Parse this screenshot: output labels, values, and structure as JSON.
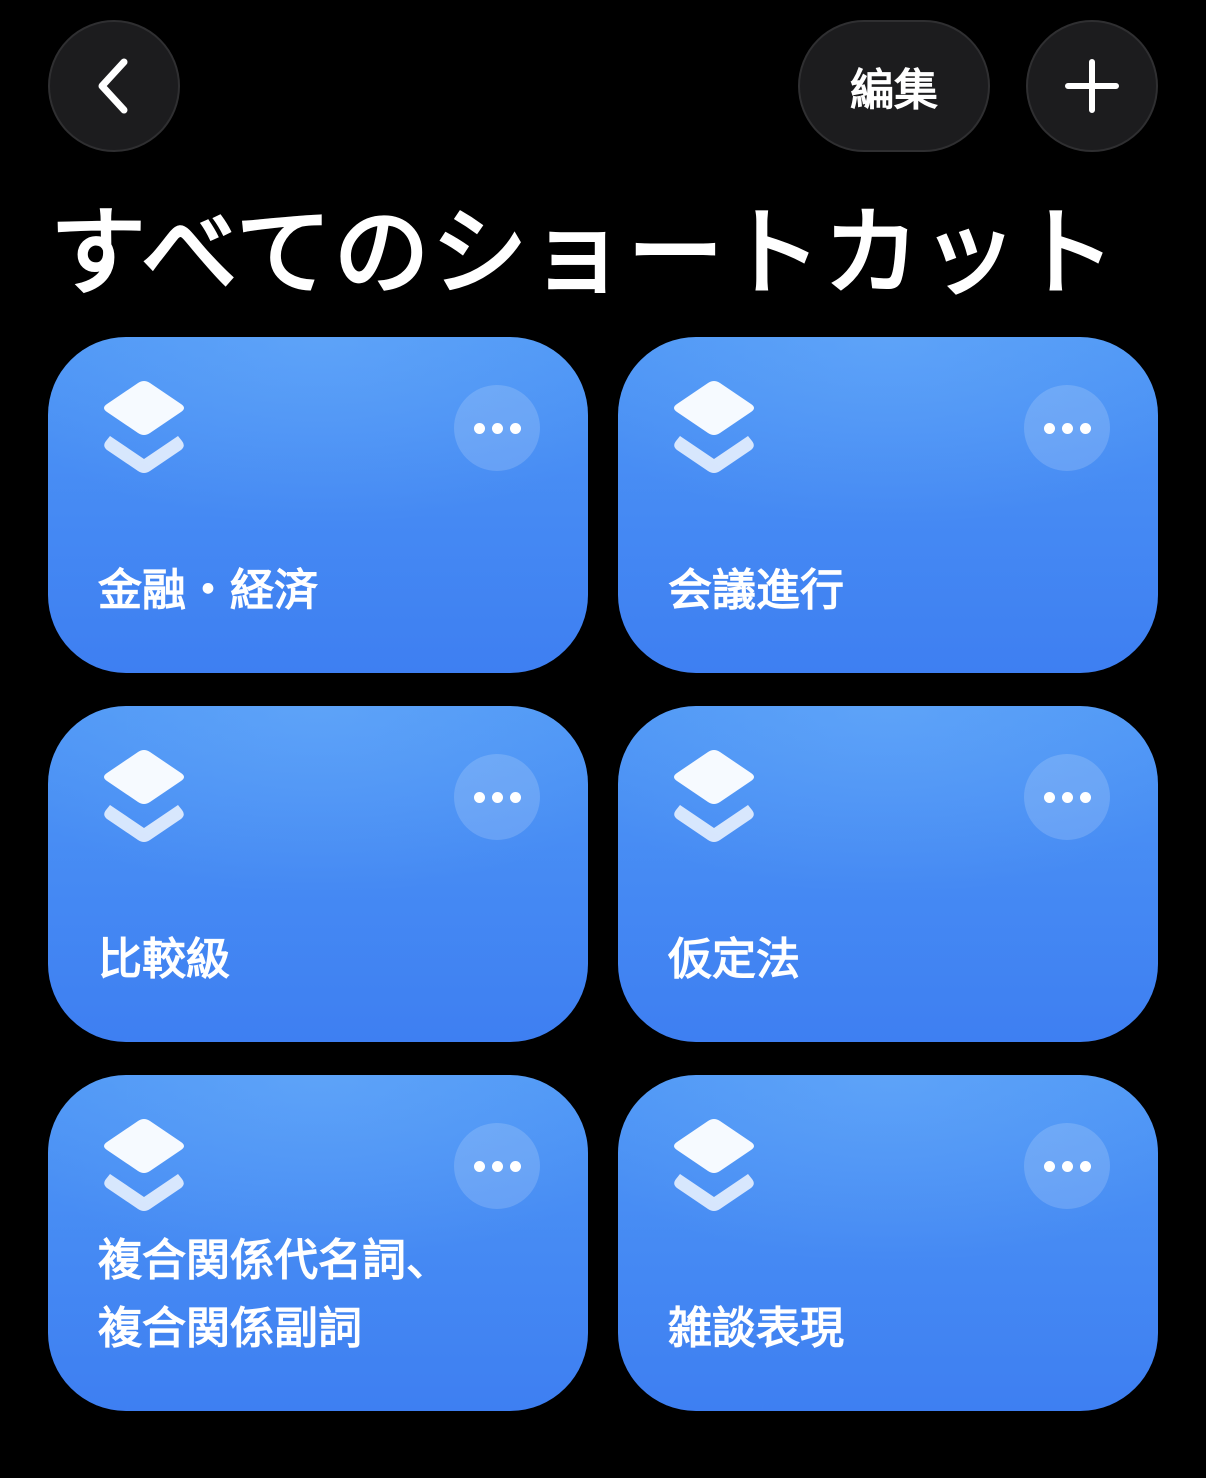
{
  "header": {
    "back_icon": "chevron-left-icon",
    "edit_label": "編集",
    "add_icon": "plus-icon"
  },
  "page_title": "すべてのショートカット",
  "colors": {
    "background": "#000000",
    "tile": "#4589f3",
    "button": "#1c1c1e"
  },
  "shortcuts": [
    {
      "label": "金融・経済",
      "icon": "layers-icon"
    },
    {
      "label": "会議進行",
      "icon": "layers-icon"
    },
    {
      "label": "比較級",
      "icon": "layers-icon"
    },
    {
      "label": "仮定法",
      "icon": "layers-icon"
    },
    {
      "label": "複合関係代名詞、\n複合関係副詞",
      "icon": "layers-icon"
    },
    {
      "label": "雑談表現",
      "icon": "layers-icon"
    }
  ]
}
